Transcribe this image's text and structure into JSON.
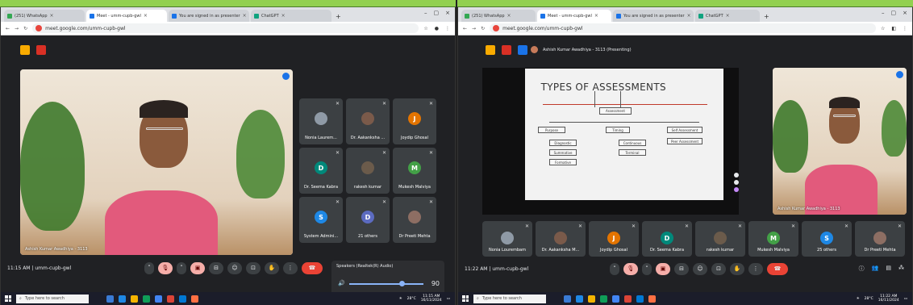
{
  "colors": {
    "band": "#92d050",
    "meet_bg": "#202124",
    "tile_bg": "#3c4043",
    "end_call": "#ea4335"
  },
  "left": {
    "tabs": [
      {
        "label": "(251) WhatsApp",
        "icon": "whatsapp-icon",
        "active": false
      },
      {
        "label": "Meet - umm-cupb-gwl",
        "icon": "meet-icon",
        "active": true
      },
      {
        "label": "You are signed in as presenter",
        "icon": "doc-icon",
        "active": false
      },
      {
        "label": "ChatGPT",
        "icon": "chatgpt-icon",
        "active": false
      }
    ],
    "url": "meet.google.com/umm-cupb-gwl",
    "main_speaker": "Ashish Kumar Awadhiya - 3113",
    "participants": [
      {
        "name": "Nonia Laurem...",
        "initial": "",
        "color": "#8f9aa6"
      },
      {
        "name": "Dr. Aakanksha ...",
        "initial": "",
        "color": "#7a5a4a"
      },
      {
        "name": "Joydip Ghosal",
        "initial": "J",
        "color": "#e37400"
      },
      {
        "name": "Dr. Seema Kabra",
        "initial": "D",
        "color": "#00897b"
      },
      {
        "name": "rakesh kumar",
        "initial": "",
        "color": "#6b5b4b"
      },
      {
        "name": "Mukesh Malviya",
        "initial": "M",
        "color": "#43a047"
      },
      {
        "name": "System Admini...",
        "initial": "S",
        "color": "#1e88e5"
      },
      {
        "name": "21 others",
        "initial": "D",
        "color": "#5c6bc0"
      },
      {
        "name": "Dr Preeti Mehta",
        "initial": "",
        "color": "#8d6e63"
      }
    ],
    "meeting_info": "11:15 AM | umm-cupb-gwl",
    "audio_popup": {
      "device": "Speakers (Realtek(R) Audio)",
      "volume": "90"
    },
    "taskbar": {
      "search": "Type here to search",
      "weather": "28°C",
      "time": "11:15 AM",
      "date": "16/11/2024"
    }
  },
  "right": {
    "tabs": [
      {
        "label": "(251) WhatsApp",
        "icon": "whatsapp-icon",
        "active": false
      },
      {
        "label": "Meet - umm-cupb-gwl",
        "icon": "meet-icon",
        "active": true
      },
      {
        "label": "You are signed in as presenter",
        "icon": "doc-icon",
        "active": false
      },
      {
        "label": "ChatGPT",
        "icon": "chatgpt-icon",
        "active": false
      }
    ],
    "url": "meet.google.com/umm-cupb-gwl",
    "presenting": "Ashish Kumar Awadhiya - 3113 (Presenting)",
    "slide": {
      "title": "TYPES OF ASSESSMENTS",
      "root": "Assessment",
      "purpose": "Purpose",
      "purpose_items": [
        "Diagnostic",
        "Summative",
        "Formative"
      ],
      "timing": "Timing",
      "timing_items": [
        "Continuous",
        "Terminal"
      ],
      "other_items": [
        "Self Assessment",
        "Peer Assessment"
      ]
    },
    "presenter_tile": "Ashish Kumar Awadhiya - 3113",
    "participants": [
      {
        "name": "Nonia Lourembam",
        "initial": "",
        "color": "#8f9aa6"
      },
      {
        "name": "Dr. Aakanksha M...",
        "initial": "",
        "color": "#7a5a4a"
      },
      {
        "name": "Joydip Ghosal",
        "initial": "J",
        "color": "#e37400"
      },
      {
        "name": "Dr. Seema Kabra",
        "initial": "D",
        "color": "#00897b"
      },
      {
        "name": "rakesh kumar",
        "initial": "",
        "color": "#6b5b4b"
      },
      {
        "name": "Mukesh Malviya",
        "initial": "M",
        "color": "#43a047"
      },
      {
        "name": "25 others",
        "initial": "S",
        "color": "#1e88e5"
      },
      {
        "name": "Dr Preeti Mehta",
        "initial": "",
        "color": "#8d6e63"
      }
    ],
    "meeting_info": "11:22 AM | umm-cupb-gwl",
    "taskbar": {
      "search": "Type here to search",
      "weather": "28°C",
      "time": "11:22 AM",
      "date": "16/11/2024"
    }
  }
}
